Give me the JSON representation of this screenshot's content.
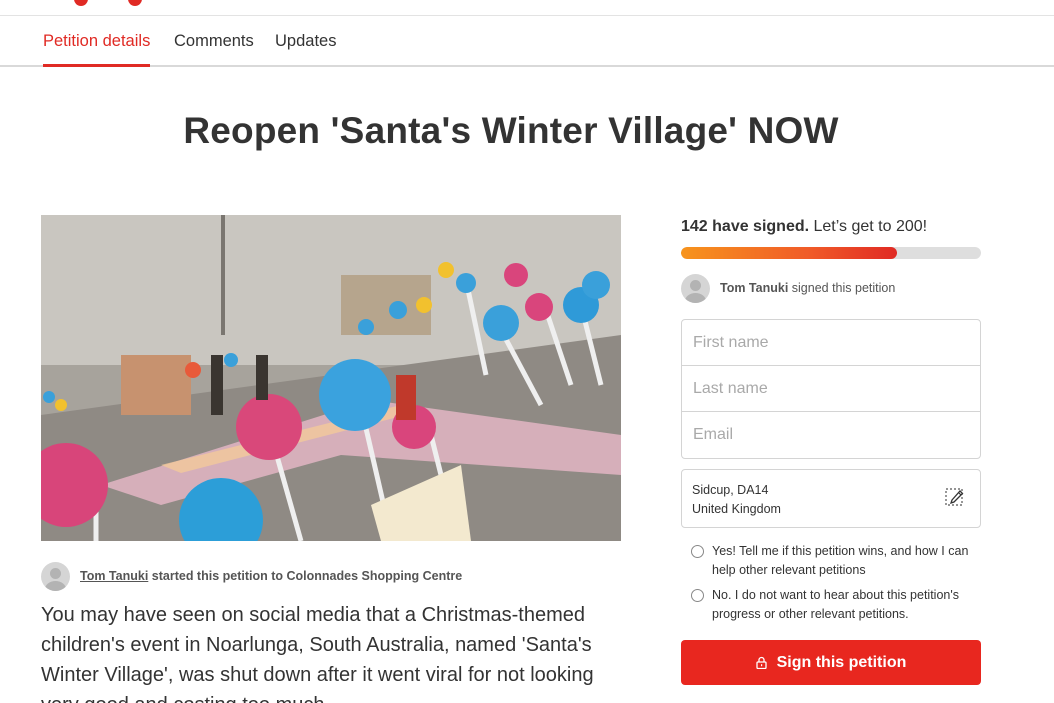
{
  "tabs": [
    {
      "label": "Petition details"
    },
    {
      "label": "Comments"
    },
    {
      "label": "Updates"
    }
  ],
  "petition": {
    "title": "Reopen 'Santa's Winter Village' NOW",
    "starter_name": "Tom Tanuki",
    "starter_suffix": " started this petition to Colonnades Shopping Centre",
    "description": "You may have seen on social media that a Christmas-themed children's event in Noarlunga, South Australia, named 'Santa's Winter Village', was shut down after it went viral for not looking very good and costing too much."
  },
  "signatures": {
    "count_text": "142 have signed.",
    "goal_text": " Let’s get to 200!",
    "signed": 142,
    "goal": 200,
    "progress_fraction": 0.72
  },
  "recent_signer": {
    "name": "Tom Tanuki",
    "action": " signed this petition"
  },
  "form": {
    "first_name_placeholder": "First name",
    "last_name_placeholder": "Last name",
    "email_placeholder": "Email",
    "location_line1": "Sidcup, DA14",
    "location_line2": "United Kingdom",
    "opt_in_yes": "Yes! Tell me if this petition wins, and how I can help other relevant petitions",
    "opt_in_no": "No. I do not want to hear about this petition's progress or other relevant petitions.",
    "sign_button": "Sign this petition"
  },
  "colors": {
    "accent": "#e02a24",
    "progress_start": "#f7941d",
    "progress_end": "#e02a24"
  },
  "icons": {
    "avatar": "default-user-icon",
    "edit": "pencil-icon",
    "lock": "lock-icon"
  }
}
